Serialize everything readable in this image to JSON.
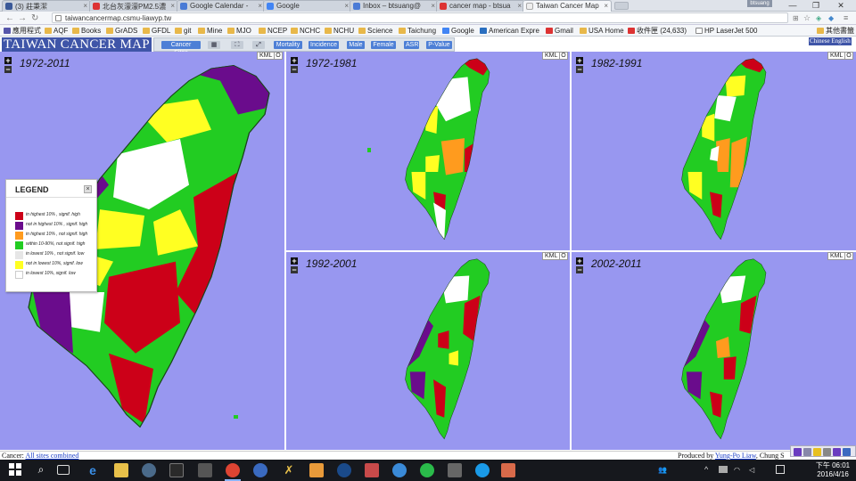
{
  "browser": {
    "tabs": [
      {
        "title": "(3) 莊秉潔",
        "color": "#3b5998"
      },
      {
        "title": "北台灰濛濛PM2.5濃",
        "color": "#d33"
      },
      {
        "title": "Google Calendar -",
        "color": "#4a7bd6"
      },
      {
        "title": "Google",
        "color": "#4285f4"
      },
      {
        "title": "Inbox – btsuang@",
        "color": "#4a7bd6"
      },
      {
        "title": "cancer map - btsua",
        "color": "#d33"
      },
      {
        "title": "Taiwan Cancer Map",
        "color": "#e9ecef"
      }
    ],
    "window_controls": [
      "—",
      "❐",
      "✕"
    ],
    "window_user": "btsuang",
    "url": "taiwancancermap.csmu-liawyp.tw",
    "bookmarks": [
      "應用程式",
      "AQF",
      "Books",
      "GrADS",
      "GFDL",
      "git",
      "Mine",
      "MJO",
      "NCEP",
      "NCHC",
      "NCHU",
      "Science",
      "Taichung",
      "Google",
      "American Expre",
      "Gmail",
      "USA Home",
      "收件匣 (24,633)",
      "HP LaserJet 500",
      "其他書籤"
    ]
  },
  "app": {
    "title": "TAIWAN CANCER MAP",
    "controls": [
      "Cancer Sites",
      "▦",
      "⛶",
      "⤢",
      "Mortality",
      "Incidence",
      "Male",
      "Female",
      "ASR",
      "P-Value"
    ],
    "language_links": "Chinese English"
  },
  "panels": [
    {
      "title": "1972-2011",
      "kml": "KML",
      "o": "O"
    },
    {
      "title": "1972-1981",
      "kml": "KML",
      "o": "O"
    },
    {
      "title": "1982-1991",
      "kml": "KML",
      "o": "O"
    },
    {
      "title": "1992-2001",
      "kml": "KML",
      "o": "O"
    },
    {
      "title": "2002-2011",
      "kml": "KML",
      "o": "O"
    }
  ],
  "legend": {
    "title": "LEGEND",
    "close": "×",
    "items": [
      {
        "label": "in highest 10% , signif. high",
        "color": "#cc0018"
      },
      {
        "label": "not in highest 10% , signif. high",
        "color": "#6a0c8c"
      },
      {
        "label": "in highest 10% , not signif. high",
        "color": "#ff9b1e"
      },
      {
        "label": "within 10-90%, not signif. high",
        "color": "#22cc22"
      },
      {
        "label": "in lowest 10% , not signif. low",
        "color": "#e6e6e6"
      },
      {
        "label": "not in lowest 10%, signif. low",
        "color": "#ffff22"
      },
      {
        "label": "in lowest 10%, signif. low",
        "color": "#ffffff"
      }
    ]
  },
  "status": {
    "left_label": "Cancer:",
    "left_link": "All sites combined",
    "right_label": "Produced by",
    "right_link": "Yung-Po Liaw",
    "right_suffix": ", Chung S"
  },
  "taskbar": {
    "time": "下午 06:01",
    "date": "2016/4/16",
    "icons": [
      "windows-start",
      "search",
      "task-view",
      "edge",
      "file-explorer",
      "steam",
      "terminal",
      "chrome",
      "vpn",
      "tool",
      "folder-app",
      "network",
      "calculator",
      "cloud",
      "line",
      "media",
      "skype",
      "pdf"
    ]
  }
}
